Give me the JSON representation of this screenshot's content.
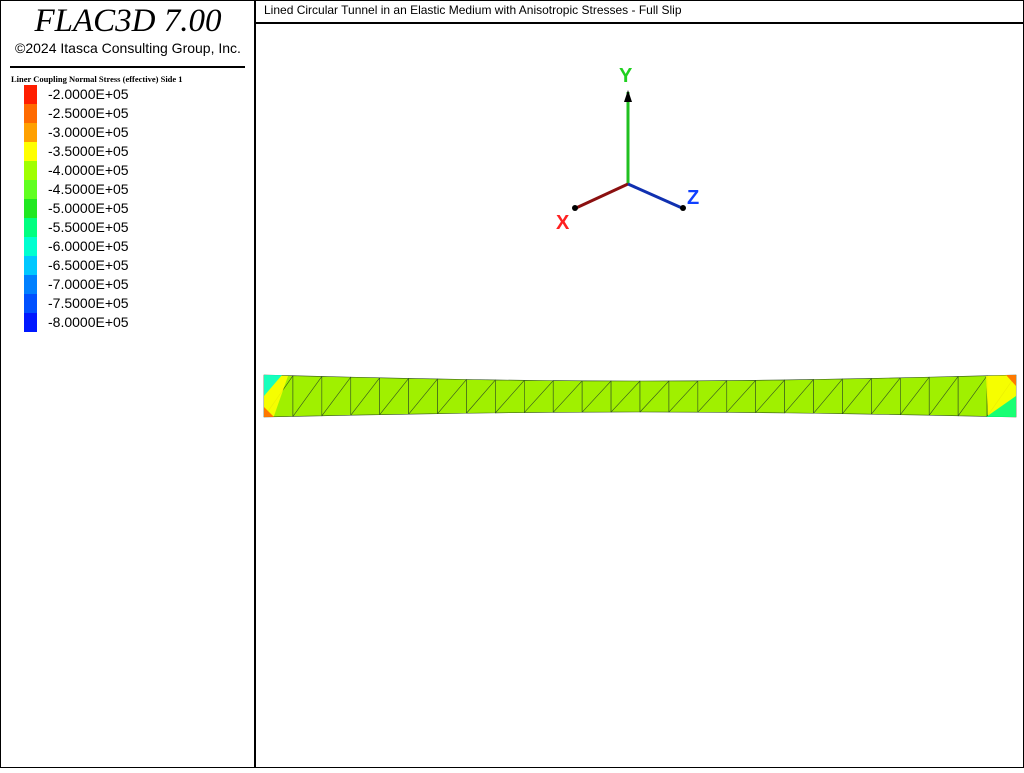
{
  "app": {
    "title": "FLAC3D 7.00",
    "copyright": "©2024 Itasca Consulting Group, Inc."
  },
  "plot": {
    "title": "Lined Circular Tunnel in an Elastic Medium with Anisotropic Stresses - Full Slip"
  },
  "legend": {
    "title": "Liner Coupling Normal Stress (effective) Side 1",
    "items": [
      {
        "label": "-2.0000E+05",
        "color": "#ff1e00"
      },
      {
        "label": "-2.5000E+05",
        "color": "#ff6a00"
      },
      {
        "label": "-3.0000E+05",
        "color": "#ffa000"
      },
      {
        "label": "-3.5000E+05",
        "color": "#ffff00"
      },
      {
        "label": "-4.0000E+05",
        "color": "#a0ff00"
      },
      {
        "label": "-4.5000E+05",
        "color": "#60ff20"
      },
      {
        "label": "-5.0000E+05",
        "color": "#20e820"
      },
      {
        "label": "-5.5000E+05",
        "color": "#00ff80"
      },
      {
        "label": "-6.0000E+05",
        "color": "#00ffd0"
      },
      {
        "label": "-6.5000E+05",
        "color": "#00c8ff"
      },
      {
        "label": "-7.0000E+05",
        "color": "#0080ff"
      },
      {
        "label": "-7.5000E+05",
        "color": "#0050ff"
      },
      {
        "label": "-8.0000E+05",
        "color": "#0018ff"
      }
    ]
  },
  "axes": {
    "x_label": "X",
    "y_label": "Y",
    "z_label": "Z",
    "x_color": "#8b1010",
    "y_color": "#20c020",
    "z_color": "#1030b0",
    "x_label_color": "#ff2020",
    "y_label_color": "#20d020",
    "z_label_color": "#1040ff"
  },
  "model": {
    "fill_color": "#a0f000",
    "mesh_line_color": "#305020"
  }
}
